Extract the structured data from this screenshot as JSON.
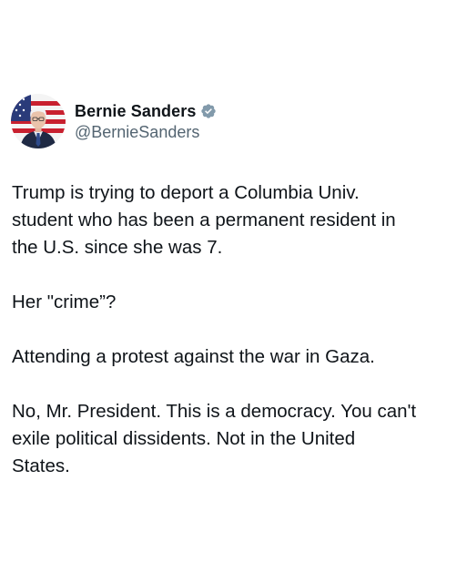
{
  "author": {
    "display_name": "Bernie Sanders",
    "handle": "@BernieSanders",
    "verified_icon": "verified-badge-icon",
    "verified_color": "#829aab",
    "avatar_icon": "profile-photo"
  },
  "tweet": {
    "paragraphs": [
      "Trump is trying to deport a Columbia Univ.\nstudent who has been a permanent resident in\nthe U.S. since she was 7.",
      "Her \"crime”?",
      "Attending a protest against the war in Gaza.",
      "No, Mr. President. This is a democracy. You can't\nexile political dissidents. Not in the United\nStates."
    ]
  },
  "colors": {
    "text": "#0f1419",
    "secondary_text": "#536471",
    "background": "#ffffff"
  }
}
